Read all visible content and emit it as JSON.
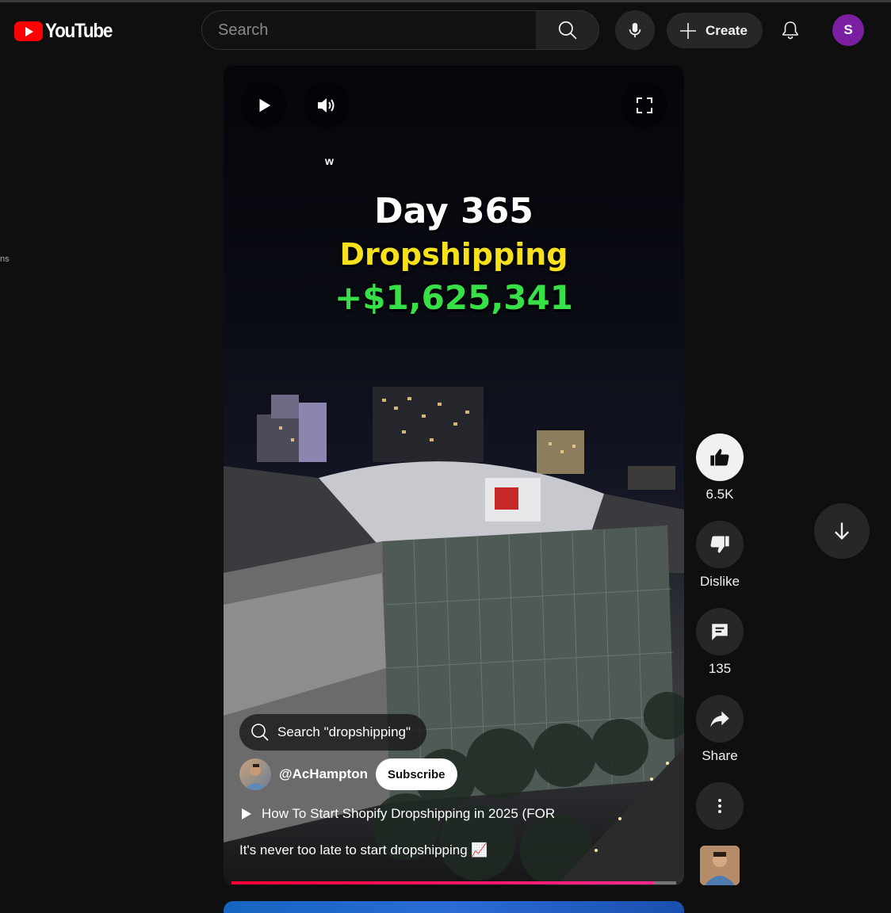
{
  "header": {
    "logo_text": "YouTube",
    "search_placeholder": "Search",
    "create_label": "Create",
    "avatar_initial": "S"
  },
  "left_edge_text": "ns",
  "player": {
    "overlay_letter": "w",
    "caption_line1": "Day 365",
    "caption_line2": "Dropshipping",
    "caption_line3": "+$1,625,341",
    "search_chip": "Search \"dropshipping\"",
    "channel_handle": "@AcHampton",
    "subscribe_label": "Subscribe",
    "related_video": "How To Start Shopify Dropshipping in 2025 (FOR",
    "description": "It's never too late to start dropshipping 📈",
    "progress": 0.95
  },
  "actions": {
    "like_count": "6.5K",
    "dislike_label": "Dislike",
    "comment_count": "135",
    "share_label": "Share"
  },
  "colors": {
    "background": "#0f0f0f",
    "brand_red": "#ff0000",
    "caption_yellow": "#f7e11a",
    "caption_green": "#37e046",
    "progress_red": "#ff0033",
    "avatar_purple": "#7b1fa2"
  },
  "icons": [
    "youtube-logo-icon",
    "search-icon",
    "mic-icon",
    "plus-icon",
    "bell-icon",
    "play-icon",
    "volume-icon",
    "fullscreen-icon",
    "thumbs-up-icon",
    "thumbs-down-icon",
    "comment-icon",
    "share-icon",
    "more-vert-icon",
    "arrow-down-icon"
  ]
}
